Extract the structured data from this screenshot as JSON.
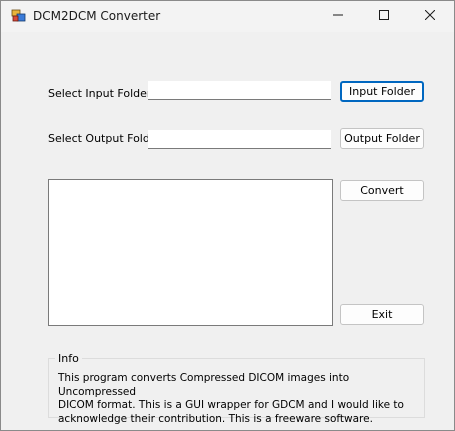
{
  "window": {
    "title": "DCM2DCM Converter"
  },
  "form": {
    "input_label": "Select Input Folder",
    "input_value": "",
    "input_button": "Input Folder",
    "output_label": "Select Output Folder",
    "output_value": "",
    "output_button": "Output Folder",
    "convert_button": "Convert",
    "exit_button": "Exit"
  },
  "info": {
    "legend": "Info",
    "text": "This program converts Compressed DICOM images into Uncompressed\nDICOM format. This is a GUI wrapper for GDCM and I would like to\nacknowledge their contribution. This is a freeware software."
  },
  "icons": {
    "app": "app-icon",
    "minimize": "minimize-icon",
    "maximize": "maximize-icon",
    "close": "close-icon"
  },
  "colors": {
    "accent": "#0067c0",
    "background": "#f0f0f0"
  }
}
